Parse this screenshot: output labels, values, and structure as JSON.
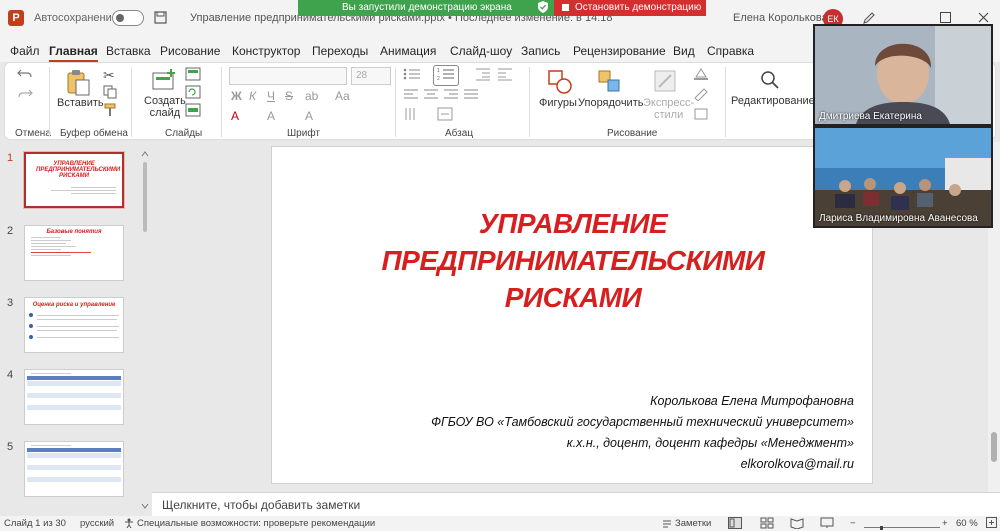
{
  "titlebar": {
    "autosave_label": "Автосохранение",
    "doc_title": "Управление предпринимательскими рисками.pptx • Последнее изменение: в 14:18",
    "user_name": "Елена Королькова",
    "user_initials": "ЕК"
  },
  "share_banner": {
    "active_text": "Вы запустили демонстрацию экрана",
    "stop_text": "Остановить демонстрацию"
  },
  "menu": {
    "tabs": [
      "Файл",
      "Главная",
      "Вставка",
      "Рисование",
      "Конструктор",
      "Переходы",
      "Анимация",
      "Слайд-шоу",
      "Запись",
      "Рецензирование",
      "Вид",
      "Справка"
    ],
    "active": "Главная"
  },
  "ribbon": {
    "groups": {
      "undo": "Отмена",
      "clipboard": "Буфер обмена",
      "slides": "Слайды",
      "font": "Шрифт",
      "paragraph": "Абзац",
      "drawing": "Рисование"
    },
    "buttons": {
      "paste": "Вставить",
      "new_slide_line1": "Создать",
      "new_slide_line2": "слайд",
      "shapes": "Фигуры",
      "arrange": "Упорядочить",
      "quick_styles_line1": "Экспресс-",
      "quick_styles_line2": "стили",
      "editing": "Редактирование"
    },
    "font_size": "28"
  },
  "thumbnails": [
    {
      "number": "1",
      "title": "УПРАВЛЕНИЕ ПРЕДПРИНИМАТЕЛЬСКИМИ РИСКАМИ",
      "selected": true
    },
    {
      "number": "2",
      "title": "Базовые понятия",
      "selected": false
    },
    {
      "number": "3",
      "title": "Оценка риска и управление",
      "selected": false
    },
    {
      "number": "4",
      "title": "",
      "selected": false
    },
    {
      "number": "5",
      "title": "",
      "selected": false
    }
  ],
  "slide": {
    "title_line1": "УПРАВЛЕНИЕ",
    "title_line2": "ПРЕДПРИНИМАТЕЛЬСКИМИ",
    "title_line3": "РИСКАМИ",
    "author": "Королькова Елена Митрофановна",
    "organization": "ФГБОУ ВО «Тамбовский государственный технический университет»",
    "position": "к.х.н., доцент, доцент кафедры «Менеджмент»",
    "email": "elkorolkova@mail.ru"
  },
  "notes_placeholder": "Щелкните, чтобы добавить заметки",
  "statusbar": {
    "slide_counter": "Слайд 1 из 30",
    "language": "русский",
    "accessibility": "Специальные возможности: проверьте рекомендации",
    "notes_button": "Заметки",
    "zoom": "60 %"
  },
  "video": {
    "participant1": "Дмитриева Екатерина",
    "participant2": "Лариса Владимировна Аванесова"
  },
  "colors": {
    "accent": "#c43e1c",
    "slide_title": "#d71f1f",
    "share_green": "#3fa34d",
    "share_red": "#d42e2e"
  }
}
